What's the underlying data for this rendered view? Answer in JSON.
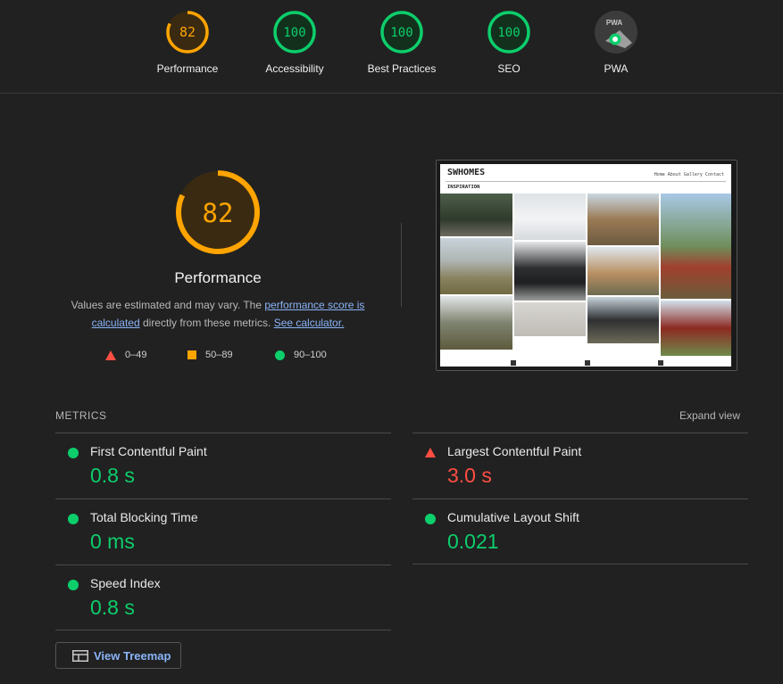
{
  "categories": [
    {
      "label": "Performance",
      "score": "82",
      "value": 82,
      "color": "#ffa400"
    },
    {
      "label": "Accessibility",
      "score": "100",
      "value": 100,
      "color": "#0cce6b"
    },
    {
      "label": "Best Practices",
      "score": "100",
      "value": 100,
      "color": "#0cce6b"
    },
    {
      "label": "SEO",
      "score": "100",
      "value": 100,
      "color": "#0cce6b"
    },
    {
      "label": "PWA",
      "score": "PWA",
      "color": "#9e9e9e"
    }
  ],
  "performance": {
    "score": "82",
    "value": 82,
    "title": "Performance",
    "desc_prefix": "Values are estimated and may vary. The ",
    "desc_link": "performance score is calculated",
    "desc_middle": " directly from these metrics. ",
    "desc_link2": "See calculator."
  },
  "legend": {
    "fail": "0–49",
    "average": "50–89",
    "pass": "90–100"
  },
  "screenshot": {
    "brand": "SWHOMES",
    "nav": "Home  About  Gallery  Contact",
    "section": "INSPIRATION"
  },
  "metrics": {
    "heading": "METRICS",
    "expand_label": "Expand view",
    "items": [
      {
        "name": "First Contentful Paint",
        "value": "0.8 s",
        "status": "pass"
      },
      {
        "name": "Largest Contentful Paint",
        "value": "3.0 s",
        "status": "fail"
      },
      {
        "name": "Total Blocking Time",
        "value": "0 ms",
        "status": "pass"
      },
      {
        "name": "Cumulative Layout Shift",
        "value": "0.021",
        "status": "pass"
      },
      {
        "name": "Speed Index",
        "value": "0.8 s",
        "status": "pass"
      }
    ]
  },
  "treemap_button": "View Treemap",
  "colors": {
    "pass": "#0cce6b",
    "average": "#ffa400",
    "fail": "#ff4e42",
    "link": "#8ab4f8",
    "background": "#212121"
  }
}
